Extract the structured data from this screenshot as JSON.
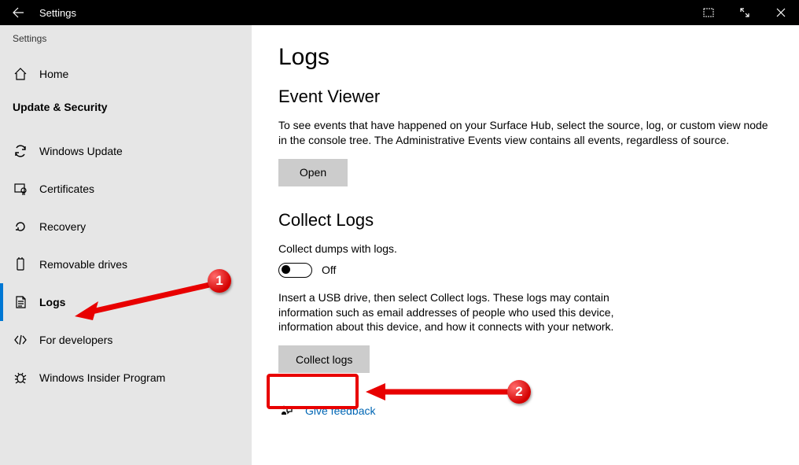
{
  "titlebar": {
    "title": "Settings"
  },
  "sidebar": {
    "crumb": "Settings",
    "home_label": "Home",
    "section_header": "Update & Security",
    "items": [
      {
        "label": "Windows Update"
      },
      {
        "label": "Certificates"
      },
      {
        "label": "Recovery"
      },
      {
        "label": "Removable drives"
      },
      {
        "label": "Logs"
      },
      {
        "label": "For developers"
      },
      {
        "label": "Windows Insider Program"
      }
    ]
  },
  "main": {
    "page_title": "Logs",
    "section1": {
      "heading": "Event Viewer",
      "description": "To see events that have happened on your Surface Hub, select the source, log, or custom view node in the console tree. The Administrative Events view contains all events, regardless of source.",
      "button": "Open"
    },
    "section2": {
      "heading": "Collect Logs",
      "subtext": "Collect dumps with logs.",
      "toggle_state": "Off",
      "description": "Insert a USB drive, then select Collect logs. These logs may contain information such as email addresses of people who used this device, information about this device, and how it connects with your network.",
      "button": "Collect logs"
    },
    "feedback_label": "Give feedback"
  },
  "annotations": {
    "callout1": "1",
    "callout2": "2"
  }
}
